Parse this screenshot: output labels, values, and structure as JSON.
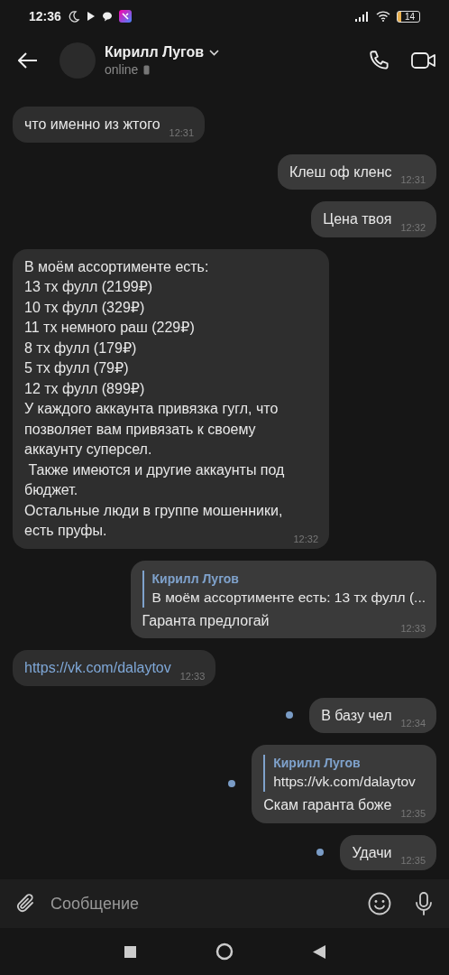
{
  "status_bar": {
    "time": "12:36",
    "battery": "14"
  },
  "header": {
    "name": "Кирилл Лугов",
    "status": "online"
  },
  "messages": [
    {
      "kind": "text",
      "outgoing": false,
      "text": "что именно из жтого",
      "time": "12:31"
    },
    {
      "kind": "text",
      "outgoing": true,
      "unread": false,
      "text": "Клеш оф кленс",
      "time": "12:31"
    },
    {
      "kind": "text",
      "outgoing": true,
      "unread": false,
      "text": "Цена твоя",
      "time": "12:32"
    },
    {
      "kind": "text",
      "outgoing": false,
      "text": "В моём ассортименте есть:\n13 тх фулл (2199₽)\n10 тх фулл (329₽)\n11 тх немного раш (229₽)\n8 тх фулл (179₽)\n5 тх фулл (79₽)\n12 тх фулл (899₽)\nУ каждого аккаунта привязка гугл, что позволяет вам привязать к своему аккаунту суперсел.\n Также имеются и другие аккаунты под бюджет.\nОстальные люди в группе мошенники, есть пруфы.",
      "time": "12:32"
    },
    {
      "kind": "reply",
      "outgoing": true,
      "unread": false,
      "quote_author": "Кирилл Лугов",
      "quote_text": "В моём ассортименте есть: 13 тх фулл (...",
      "text": "Гаранта предлогай",
      "time": "12:33"
    },
    {
      "kind": "link",
      "outgoing": false,
      "text": "https://vk.com/dalaytov",
      "time": "12:33"
    },
    {
      "kind": "text",
      "outgoing": true,
      "unread": true,
      "text": "В базу чел",
      "time": "12:34"
    },
    {
      "kind": "reply",
      "outgoing": true,
      "unread": true,
      "quote_author": "Кирилл Лугов",
      "quote_text": "https://vk.com/dalaytov",
      "text": "Скам гаранта боже",
      "time": "12:35"
    },
    {
      "kind": "text",
      "outgoing": true,
      "unread": true,
      "text": "Удачи",
      "time": "12:35"
    }
  ],
  "composer": {
    "placeholder": "Сообщение"
  }
}
